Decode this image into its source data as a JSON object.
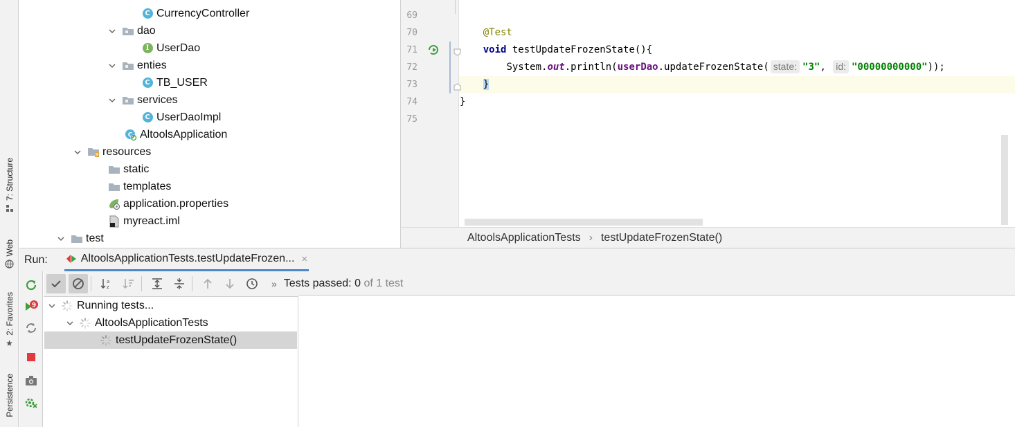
{
  "left_strip": {
    "tabs": [
      {
        "label": "7: Structure",
        "icon": "structure-icon"
      },
      {
        "label": "Web",
        "icon": "globe-icon"
      },
      {
        "label": "2: Favorites",
        "icon": "star-icon"
      },
      {
        "label": "Persistence",
        "icon": "persistence-icon"
      }
    ]
  },
  "project_tree": {
    "items": [
      {
        "label": "CurrencyController",
        "icon": "class-icon",
        "icon_letter": "C"
      },
      {
        "label": "dao",
        "icon": "folder-icon"
      },
      {
        "label": "UserDao",
        "icon": "interface-icon",
        "icon_letter": "I"
      },
      {
        "label": "enties",
        "icon": "folder-icon"
      },
      {
        "label": "TB_USER",
        "icon": "class-icon",
        "icon_letter": "C"
      },
      {
        "label": "services",
        "icon": "folder-icon"
      },
      {
        "label": "UserDaoImpl",
        "icon": "class-icon",
        "icon_letter": "C"
      },
      {
        "label": "AltoolsApplication",
        "icon": "spring-boot-class-icon"
      },
      {
        "label": "resources",
        "icon": "resources-folder-icon"
      },
      {
        "label": "static",
        "icon": "folder-icon"
      },
      {
        "label": "templates",
        "icon": "folder-icon"
      },
      {
        "label": "application.properties",
        "icon": "spring-properties-icon"
      },
      {
        "label": "myreact.iml",
        "icon": "iml-file-icon"
      },
      {
        "label": "test",
        "icon": "folder-icon"
      }
    ]
  },
  "editor": {
    "line_numbers": [
      "69",
      "70",
      "71",
      "72",
      "73",
      "74",
      "75"
    ],
    "annotation": "@Test",
    "kw_void": "void",
    "method_decl": " testUpdateFrozenState(){",
    "line72_prefix": "System.",
    "line72_field": "out",
    "line72_call": ".println(",
    "line72_var": "userDao",
    "line72_method": ".updateFrozenState(",
    "hint_state": "state:",
    "arg_state": "\"3\"",
    "comma": ",",
    "hint_id": "id:",
    "arg_id": "\"00000000000\"",
    "line72_end": "));",
    "close_brace_inner": "}",
    "close_brace_outer": "}"
  },
  "breadcrumb": {
    "class": "AltoolsApplicationTests",
    "separator": "›",
    "method": "testUpdateFrozenState()"
  },
  "run_panel": {
    "label": "Run:",
    "tab_title": "AltoolsApplicationTests.testUpdateFrozen...",
    "tab_close": "×",
    "status_prefix": "Tests passed:",
    "status_count": "0",
    "status_suffix": "of 1 test",
    "more_glyph": "»",
    "tree": [
      {
        "label": "Running tests...",
        "level": 0
      },
      {
        "label": "AltoolsApplicationTests",
        "level": 1
      },
      {
        "label": "testUpdateFrozenState()",
        "level": 2
      }
    ]
  },
  "colors": {
    "accent": "#4a88c7",
    "class_icon": "#54b3d9",
    "interface_icon": "#7cb45f",
    "stop_button": "#e0393e",
    "rerun_icon": "#3c9f3c"
  }
}
